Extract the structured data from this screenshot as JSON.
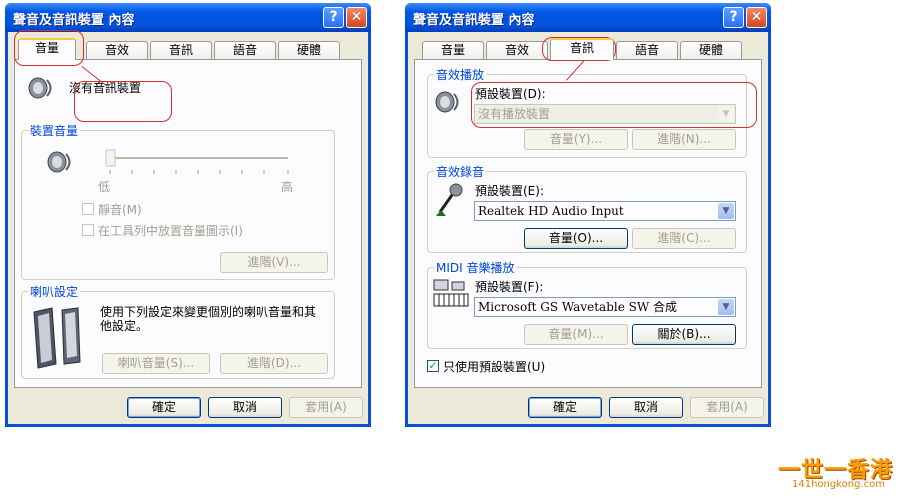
{
  "dialog_left": {
    "title": "聲音及音訊裝置 內容",
    "tabs": [
      "音量",
      "音效",
      "音訊",
      "語音",
      "硬體"
    ],
    "active_tab": "音量",
    "no_device_text": "沒有音訊裝置",
    "device_volume": {
      "group_title": "裝置音量",
      "low_label": "低",
      "high_label": "高",
      "mute_label": "靜音(M)",
      "tray_icon_label": "在工具列中放置音量圖示(I)",
      "advanced_button": "進階(V)..."
    },
    "speaker_settings": {
      "group_title": "喇叭設定",
      "description": "使用下列設定來變更個別的喇叭音量和其他設定。",
      "speaker_volume_button": "喇叭音量(S)...",
      "advanced_button": "進階(D)..."
    },
    "buttons": {
      "ok": "確定",
      "cancel": "取消",
      "apply": "套用(A)"
    }
  },
  "dialog_right": {
    "title": "聲音及音訊裝置 內容",
    "tabs": [
      "音量",
      "音效",
      "音訊",
      "語音",
      "硬體"
    ],
    "active_tab": "音訊",
    "playback": {
      "group_title": "音效播放",
      "default_device_label": "預設裝置(D):",
      "default_device_value": "沒有播放裝置",
      "volume_button": "音量(Y)...",
      "advanced_button": "進階(N)..."
    },
    "recording": {
      "group_title": "音效錄音",
      "default_device_label": "預設裝置(E):",
      "default_device_value": "Realtek HD Audio Input",
      "volume_button": "音量(O)...",
      "advanced_button": "進階(C)..."
    },
    "midi": {
      "group_title": "MIDI 音樂播放",
      "default_device_label": "預設裝置(F):",
      "default_device_value": "Microsoft GS Wavetable SW 合成",
      "volume_button": "音量(M)...",
      "about_button": "關於(B)..."
    },
    "use_default_only_label": "只使用預設裝置(U)",
    "use_default_only_checked": true,
    "buttons": {
      "ok": "確定",
      "cancel": "取消",
      "apply": "套用(A)"
    }
  },
  "watermark": {
    "chinese": "一世一香港",
    "url": "141hongkong.com"
  },
  "colors": {
    "titlebar": "#0054e3",
    "face": "#ece9d8",
    "group_title": "#0046d5",
    "annotation": "#d0312d",
    "logo": "#ff9b00"
  }
}
